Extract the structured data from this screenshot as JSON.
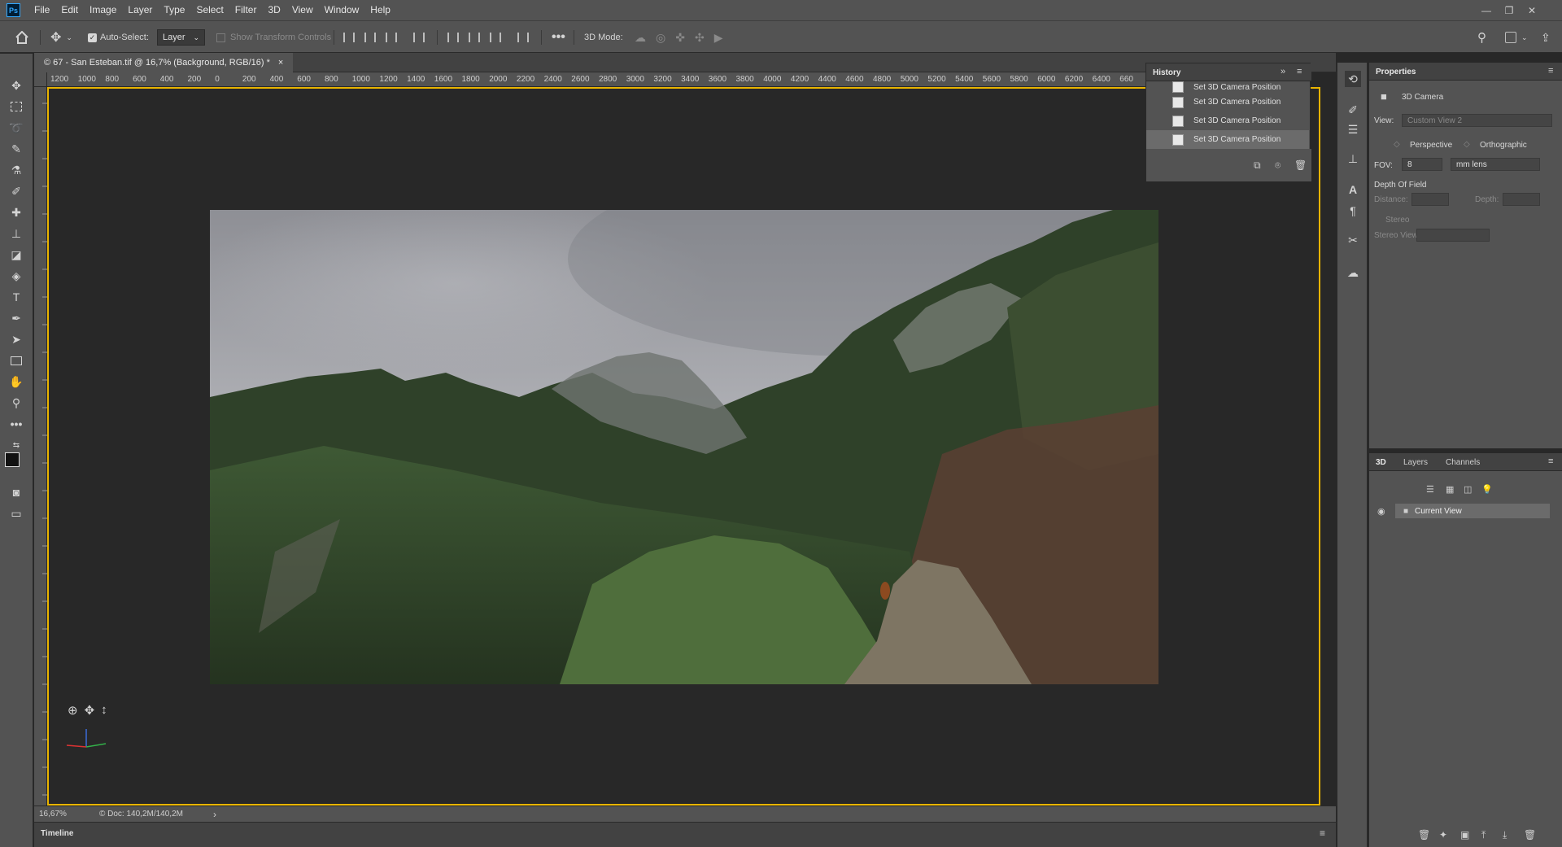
{
  "menubar": {
    "app_logo": "Ps",
    "items": [
      "File",
      "Edit",
      "Image",
      "Layer",
      "Type",
      "Select",
      "Filter",
      "3D",
      "View",
      "Window",
      "Help"
    ]
  },
  "options": {
    "auto_select_label": "Auto-Select:",
    "layer_select": "Layer",
    "show_transform_label": "Show Transform Controls",
    "mode_label": "3D Mode:"
  },
  "document": {
    "tab_title": "© 67 - San Esteban.tif @ 16,7% (Background, RGB/16) *",
    "tab_close": "×",
    "ruler_labels": [
      "1200",
      "1000",
      "800",
      "600",
      "400",
      "200",
      "0",
      "200",
      "400",
      "600",
      "800",
      "1000",
      "1200",
      "1400",
      "1600",
      "1800",
      "2000",
      "2200",
      "2400",
      "2600",
      "2800",
      "3000",
      "3200",
      "3400",
      "3600",
      "3800",
      "4000",
      "4200",
      "4400",
      "4600",
      "4800",
      "5000",
      "5200",
      "5400",
      "5600",
      "5800",
      "6000",
      "6200",
      "6400",
      "660"
    ]
  },
  "status": {
    "zoom": "16,67%",
    "doc_info": "© Doc: 140,2M/140,2M",
    "arrow": "›"
  },
  "timeline": {
    "label": "Timeline"
  },
  "history": {
    "title": "History",
    "rows": [
      "Set 3D Camera Position",
      "Set 3D Camera Position",
      "Set 3D Camera Position",
      "Set 3D Camera Position"
    ]
  },
  "properties": {
    "title": "Properties",
    "section": "3D Camera",
    "view_label": "View:",
    "view_value": "Custom View 2",
    "perspective": "Perspective",
    "orthographic": "Orthographic",
    "fov_label": "FOV:",
    "fov_value": "8",
    "fov_unit": "mm lens",
    "dof_title": "Depth Of Field",
    "distance_label": "Distance:",
    "depth_label": "Depth:",
    "stereo_label": "Stereo",
    "stereo_view_label": "Stereo View:"
  },
  "panel3d": {
    "tabs": [
      "3D",
      "Layers",
      "Channels"
    ],
    "layer_name": "Current View"
  },
  "colors": {
    "chrome": "#535353",
    "canvas_border": "#e8b400",
    "selection": "#6b6b6b"
  }
}
